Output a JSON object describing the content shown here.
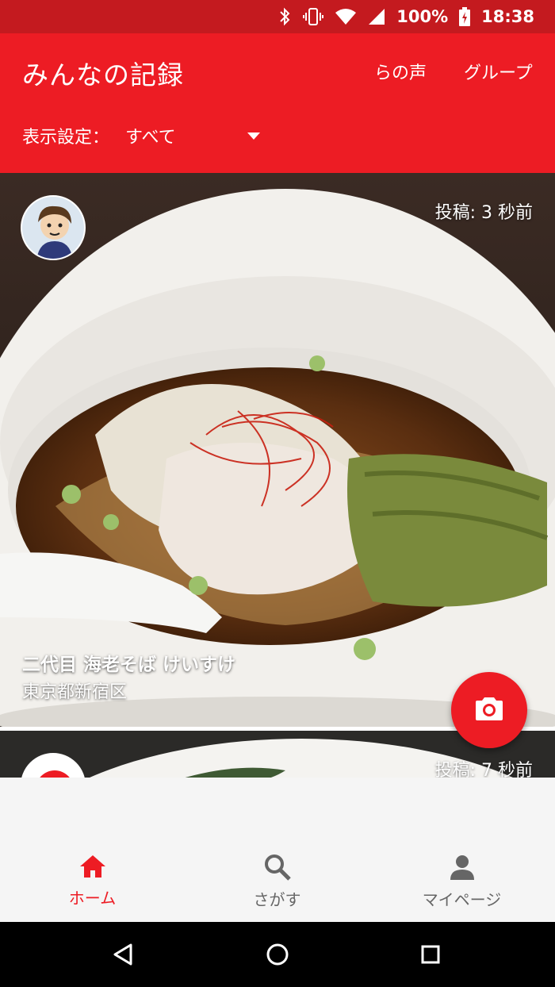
{
  "status_bar": {
    "battery": "100%",
    "time": "18:38",
    "icons": [
      "bluetooth-icon",
      "vibrate-icon",
      "wifi-icon",
      "signal-icon",
      "battery-charging-icon"
    ]
  },
  "app_bar": {
    "title": "みんなの記録",
    "tabs": [
      {
        "label": "らの声"
      },
      {
        "label": "グループ"
      }
    ],
    "filter": {
      "label": "表示設定：",
      "value": "すべて",
      "icon": "dropdown-caret-icon"
    }
  },
  "feed": {
    "posts": [
      {
        "time": "投稿: 3 秒前",
        "shop": "二代目 海老そば けいすけ",
        "area": "東京都新宿区",
        "avatar": "user-avatar-illustration"
      },
      {
        "time": "投稿: 7 秒前",
        "avatar": "user-avatar-logo"
      }
    ]
  },
  "fab": {
    "icon": "camera-icon"
  },
  "bottom_nav": {
    "items": [
      {
        "label": "ホーム",
        "icon": "home-icon",
        "active": true
      },
      {
        "label": "さがす",
        "icon": "search-icon",
        "active": false
      },
      {
        "label": "マイページ",
        "icon": "person-icon",
        "active": false
      }
    ]
  },
  "colors": {
    "primary": "#ed1c24",
    "status_bar": "#c41a1f",
    "nav_inactive": "#666666",
    "nav_background": "#f5f5f5"
  }
}
